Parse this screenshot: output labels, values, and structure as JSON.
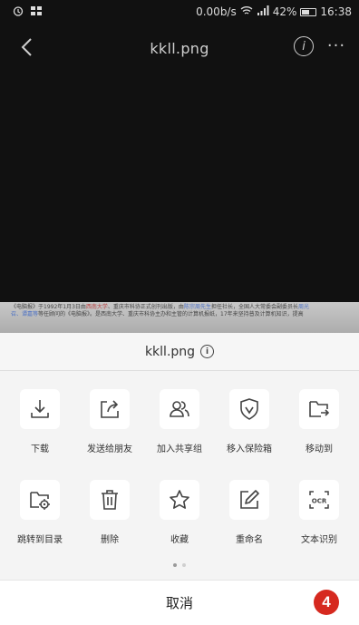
{
  "status_bar": {
    "speed": "0.00b/s",
    "battery": "42%",
    "time": "16:38"
  },
  "title_bar": {
    "title": "kkll.png",
    "info_symbol": "i",
    "more_symbol": "···"
  },
  "document_preview": {
    "line1_a": "《电脑报》于1992年1月3日由",
    "line1_b": "西南大学",
    "line1_c": "、重庆市科协正式创刊出版，由",
    "line1_d": "陈宗周先生",
    "line1_e": "担任社长，全国人大常委会副委员长",
    "line1_f": "周光",
    "line2_a": "召、谭嘉等",
    "line2_b": "等任顾问的《电脑报》。是西南大学、重庆市科协主办和主管的计算机报纸，17年来坚持普及计算机知识，提高"
  },
  "sheet": {
    "filename": "kkll.png",
    "info_symbol": "i",
    "row1": [
      {
        "label": "下载",
        "icon": "download-icon"
      },
      {
        "label": "发送给朋友",
        "icon": "share-icon"
      },
      {
        "label": "加入共享组",
        "icon": "group-icon"
      },
      {
        "label": "移入保险箱",
        "icon": "shield-icon"
      },
      {
        "label": "移动到",
        "icon": "folder-move-icon"
      }
    ],
    "row2": [
      {
        "label": "跳转到目录",
        "icon": "folder-locate-icon"
      },
      {
        "label": "删除",
        "icon": "trash-icon"
      },
      {
        "label": "收藏",
        "icon": "star-icon"
      },
      {
        "label": "重命名",
        "icon": "edit-icon"
      },
      {
        "label": "文本识别",
        "icon": "ocr-icon",
        "icon_text": "OCR"
      }
    ],
    "page_dots": {
      "count": 2,
      "active": 0
    },
    "cancel_label": "取消"
  },
  "badge": "4"
}
